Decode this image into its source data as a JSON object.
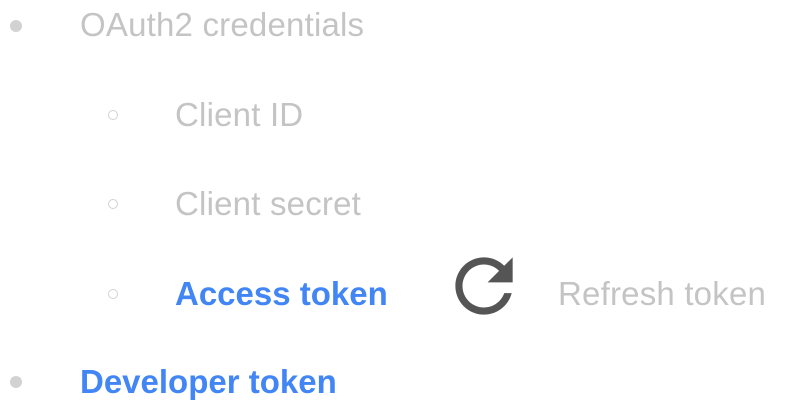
{
  "list": {
    "items": [
      {
        "label": "OAuth2 credentials",
        "children": [
          {
            "label": "Client ID"
          },
          {
            "label": "Client secret"
          },
          {
            "label": "Access token",
            "related_label": "Refresh token"
          }
        ]
      },
      {
        "label": "Developer token"
      }
    ]
  },
  "icons": {
    "refresh": "refresh-icon"
  },
  "colors": {
    "muted_text": "#c4c4c4",
    "highlight_text": "#4285f4",
    "bullet": "#d2d2d2",
    "icon": "#555555"
  }
}
